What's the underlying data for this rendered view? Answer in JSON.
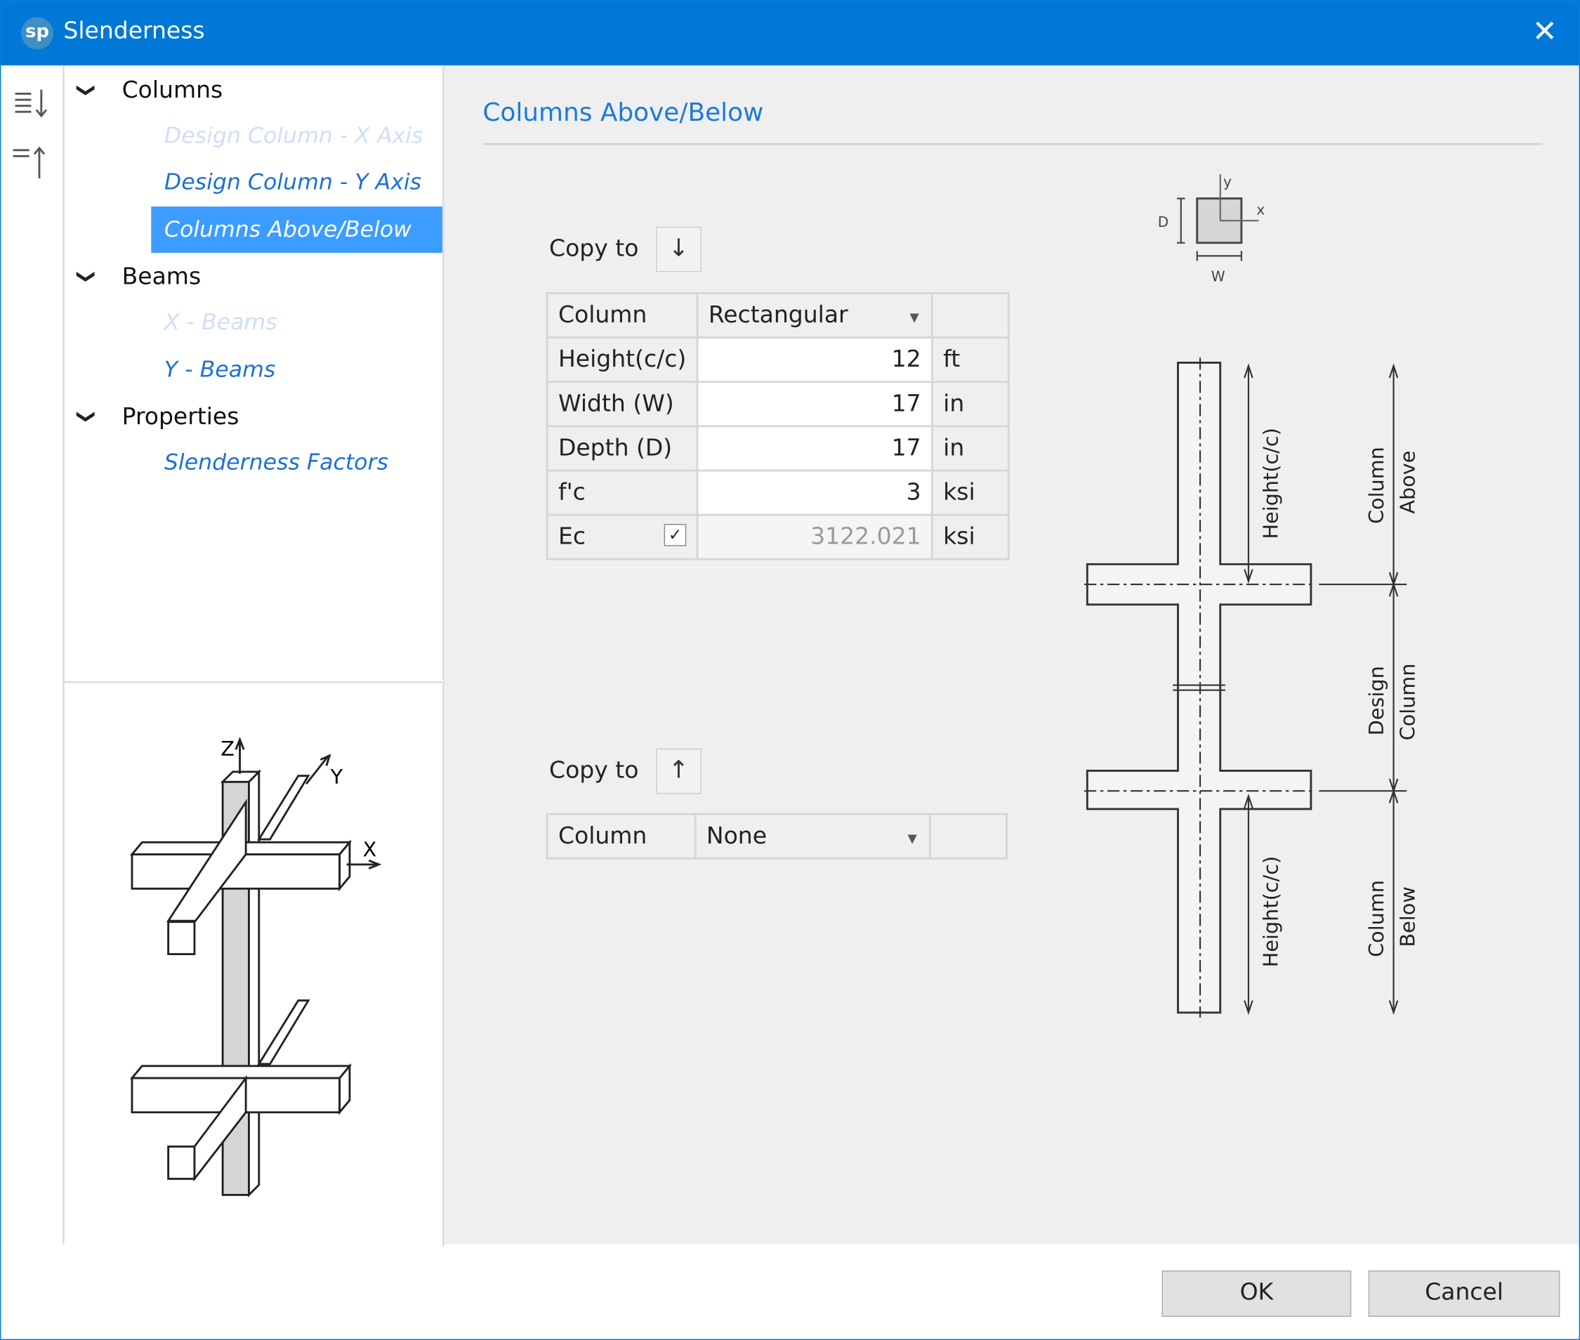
{
  "window": {
    "title": "Slenderness",
    "app_icon_text": "sp",
    "accent": "#0078d7"
  },
  "toolbar": {
    "expand_all": "expand-all",
    "collapse_all": "collapse-all"
  },
  "tree": {
    "categories": [
      {
        "label": "Columns",
        "items": [
          {
            "label": "Design Column - X Axis",
            "state": "disabled"
          },
          {
            "label": "Design Column - Y Axis",
            "state": "normal"
          },
          {
            "label": "Columns Above/Below",
            "state": "selected"
          }
        ]
      },
      {
        "label": "Beams",
        "items": [
          {
            "label": "X - Beams",
            "state": "disabled"
          },
          {
            "label": "Y - Beams",
            "state": "normal"
          }
        ]
      },
      {
        "label": "Properties",
        "items": [
          {
            "label": "Slenderness Factors",
            "state": "normal"
          }
        ]
      }
    ]
  },
  "preview": {
    "axis_z": "Z",
    "axis_y": "Y",
    "axis_x": "X"
  },
  "main": {
    "header": "Columns Above/Below",
    "above": {
      "copy_to_label": "Copy to",
      "rows": [
        {
          "label": "Column",
          "value": "Rectangular",
          "unit": ""
        },
        {
          "label": "Height(c/c)",
          "value": "12",
          "unit": "ft"
        },
        {
          "label": "Width (W)",
          "value": "17",
          "unit": "in"
        },
        {
          "label": "Depth (D)",
          "value": "17",
          "unit": "in"
        },
        {
          "label": "f'c",
          "value": "3",
          "unit": "ksi"
        },
        {
          "label": "Ec",
          "value": "3122.021",
          "unit": "ksi",
          "checked": true
        }
      ]
    },
    "below": {
      "copy_to_label": "Copy to",
      "rows": [
        {
          "label": "Column",
          "value": "None",
          "unit": ""
        }
      ]
    },
    "section_diagram": {
      "d": "D",
      "w": "W",
      "x": "x",
      "y": "y"
    },
    "elevation_diagram": {
      "height_top": "Height(c/c)",
      "height_bottom": "Height(c/c)",
      "above_1": "Column",
      "above_2": "Above",
      "design_1": "Design",
      "design_2": "Column",
      "below_1": "Column",
      "below_2": "Below"
    }
  },
  "footer": {
    "ok": "OK",
    "cancel": "Cancel"
  }
}
